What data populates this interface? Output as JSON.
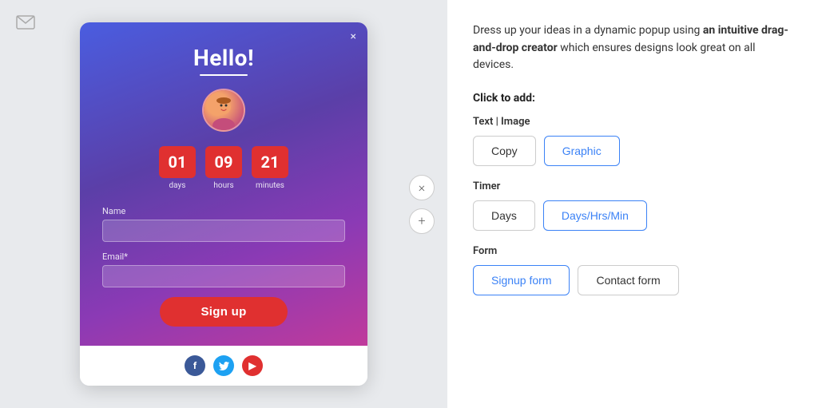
{
  "left": {
    "email_icon": "✉",
    "side_controls": {
      "remove": "×",
      "add": "+"
    },
    "popup": {
      "close": "×",
      "title": "Hello!",
      "timer": {
        "days": {
          "value": "01",
          "label": "days"
        },
        "hours": {
          "value": "09",
          "label": "hours"
        },
        "minutes": {
          "value": "21",
          "label": "minutes"
        }
      },
      "name_label": "Name",
      "email_label": "Email*",
      "signup_btn": "Sign up",
      "social": {
        "fb": "f",
        "tw": "t",
        "yt": "▶"
      }
    }
  },
  "right": {
    "description_normal": "Dress up your ideas in a dynamic popup using ",
    "description_bold": "an intuitive drag-and-drop creator",
    "description_end": " which ensures designs look great on all devices.",
    "click_to_add": "Click to add:",
    "sections": {
      "text_image": {
        "label": "Text | Image",
        "buttons": [
          {
            "id": "copy",
            "label": "Copy",
            "active": false
          },
          {
            "id": "graphic",
            "label": "Graphic",
            "active": true
          }
        ]
      },
      "timer": {
        "label": "Timer",
        "buttons": [
          {
            "id": "days",
            "label": "Days",
            "active": false
          },
          {
            "id": "days-hrs-min",
            "label": "Days/Hrs/Min",
            "active": true
          }
        ]
      },
      "form": {
        "label": "Form",
        "buttons": [
          {
            "id": "signup-form",
            "label": "Signup form",
            "active": true
          },
          {
            "id": "contact-form",
            "label": "Contact form",
            "active": false
          }
        ]
      }
    }
  }
}
